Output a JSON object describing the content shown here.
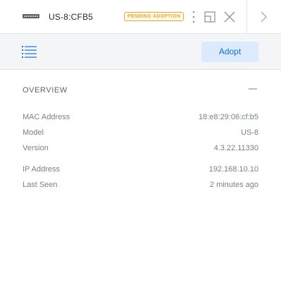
{
  "header": {
    "device_icon": "switch-device-icon",
    "device_name": "US-8:CFB5",
    "status_badge": "PENDING ADOPTION",
    "status_color": "#f5a623",
    "icons": [
      "more-vertical-icon",
      "popout-window-icon",
      "close-icon",
      "chevron-right-icon"
    ]
  },
  "toolbar": {
    "list_icon": "list-icon",
    "adopt_label": "Adopt",
    "accent": "#1570e2"
  },
  "overview": {
    "title": "OVERVIEW",
    "collapse_icon": "minus-icon",
    "rows": [
      {
        "label": "MAC Address",
        "value": "18:e8:29:06:cf:b5"
      },
      {
        "label": "Model",
        "value": "US-8"
      },
      {
        "label": "Version",
        "value": "4.3.22.11330"
      },
      {
        "label": "IP Address",
        "value": "192.168.10.10"
      },
      {
        "label": "Last Seen",
        "value": "2 minutes ago"
      }
    ]
  }
}
